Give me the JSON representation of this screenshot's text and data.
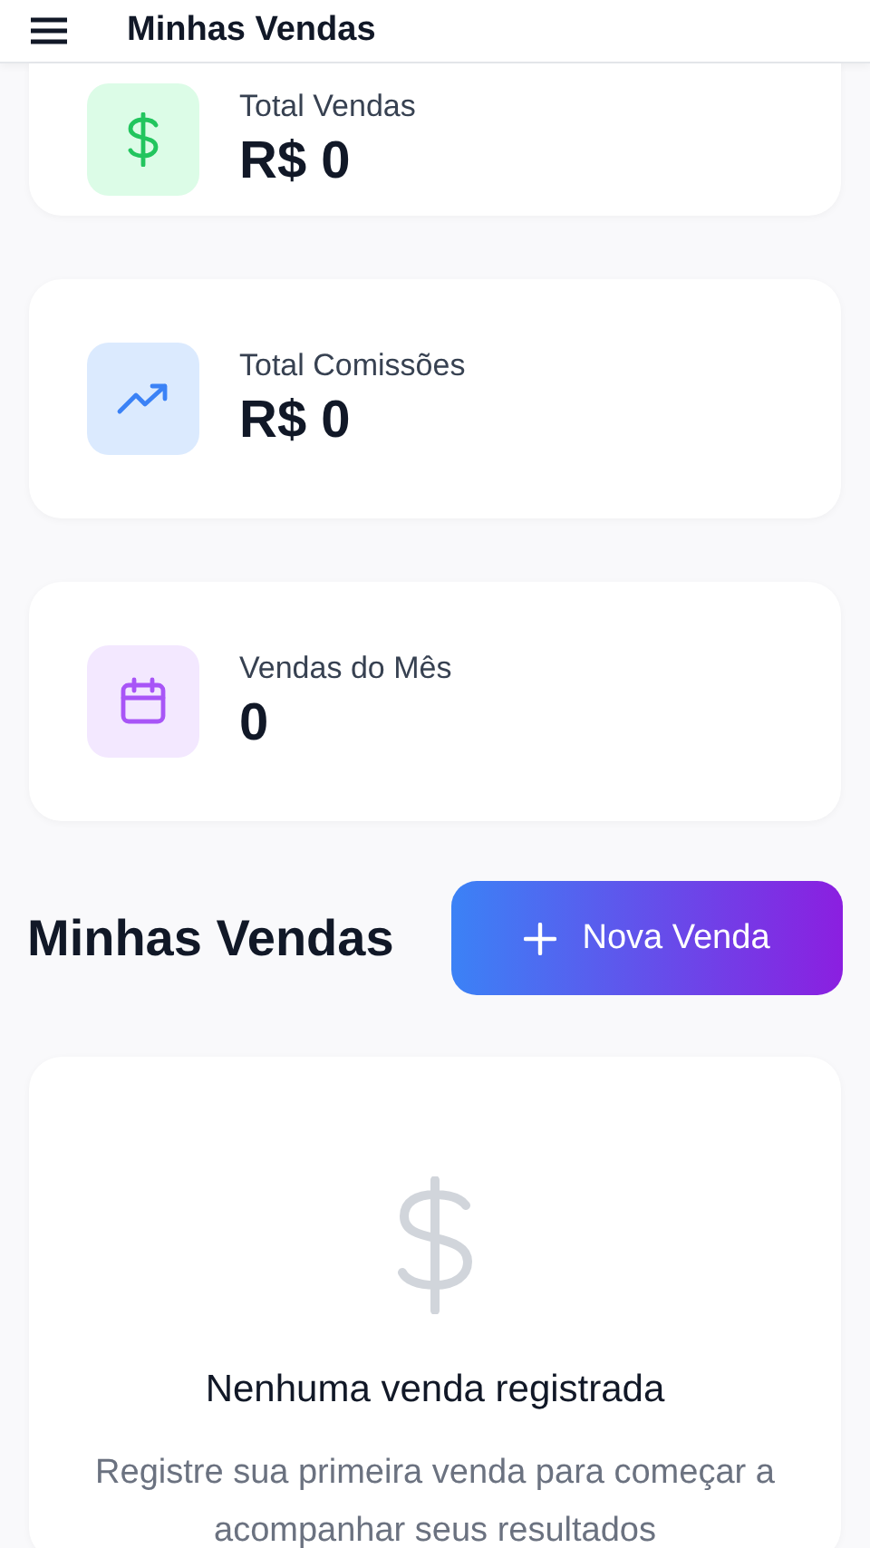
{
  "header": {
    "title": "Minhas Vendas"
  },
  "stats": [
    {
      "label": "Total Vendas",
      "value": "R$ 0",
      "kind": "dollar",
      "color": "#22c55e"
    },
    {
      "label": "Total Comissões",
      "value": "R$ 0",
      "kind": "trend",
      "color": "#3b82f6"
    },
    {
      "label": "Vendas do Mês",
      "value": "0",
      "kind": "calendar",
      "color": "#a855f7"
    }
  ],
  "section": {
    "title": "Minhas Vendas",
    "button": "Nova Venda"
  },
  "empty": {
    "title": "Nenhuma venda registrada",
    "text": "Registre sua primeira venda para começar a acompanhar seus resultados"
  }
}
